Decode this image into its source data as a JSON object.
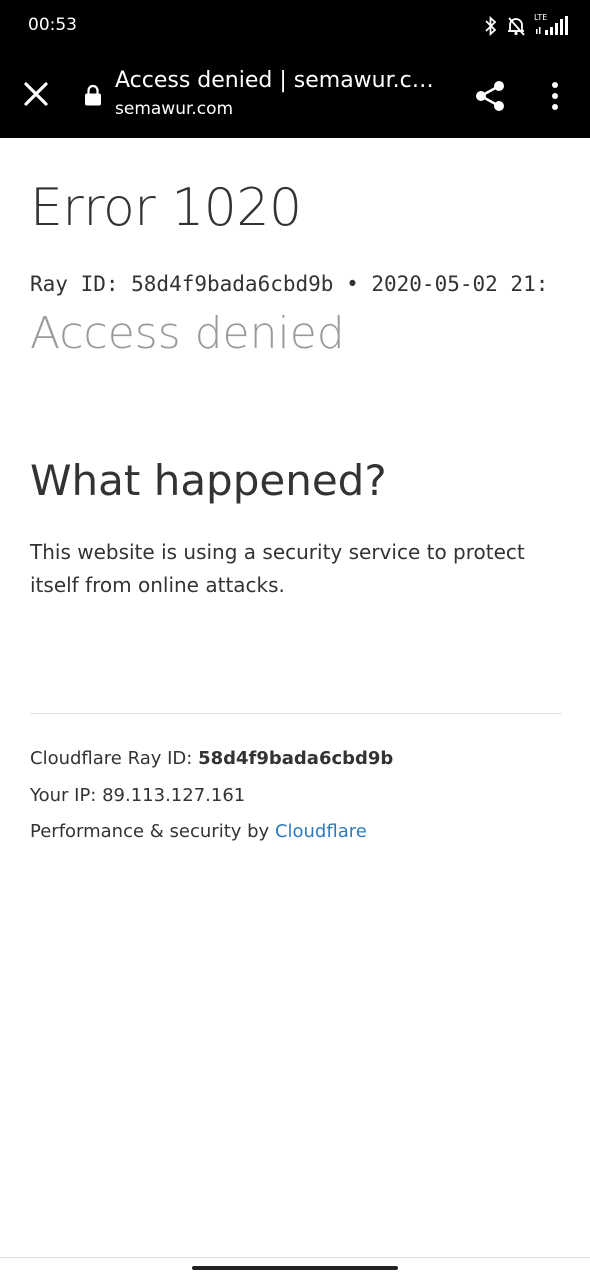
{
  "status_bar": {
    "time": "00:53",
    "network_label": "LTE",
    "icons": [
      "bluetooth-icon",
      "notifications-off-icon",
      "signal-icon"
    ]
  },
  "toolbar": {
    "title": "Access denied | semawur.co...",
    "url": "semawur.com",
    "icons": [
      "close-icon",
      "lock-icon",
      "share-icon",
      "more-vert-icon"
    ]
  },
  "page": {
    "error_title": "Error 1020",
    "ray_line": "Ray ID: 58d4f9bada6cbd9b • 2020-05-02 21:",
    "access_denied": "Access denied",
    "what_happened": "What happened?",
    "explanation": "This website is using a security service to protect itself from online attacks.",
    "footer": {
      "ray_label": "Cloudflare Ray ID: ",
      "ray_value": "58d4f9bada6cbd9b",
      "ip_line": "Your IP: 89.113.127.161",
      "perf_prefix": "Performance & security by ",
      "cloudflare_link": "Cloudflare"
    }
  },
  "colors": {
    "toolbar_bg": "#000000",
    "link": "#2f7bbf",
    "muted_heading": "#9a9a9a",
    "text": "#333333"
  }
}
